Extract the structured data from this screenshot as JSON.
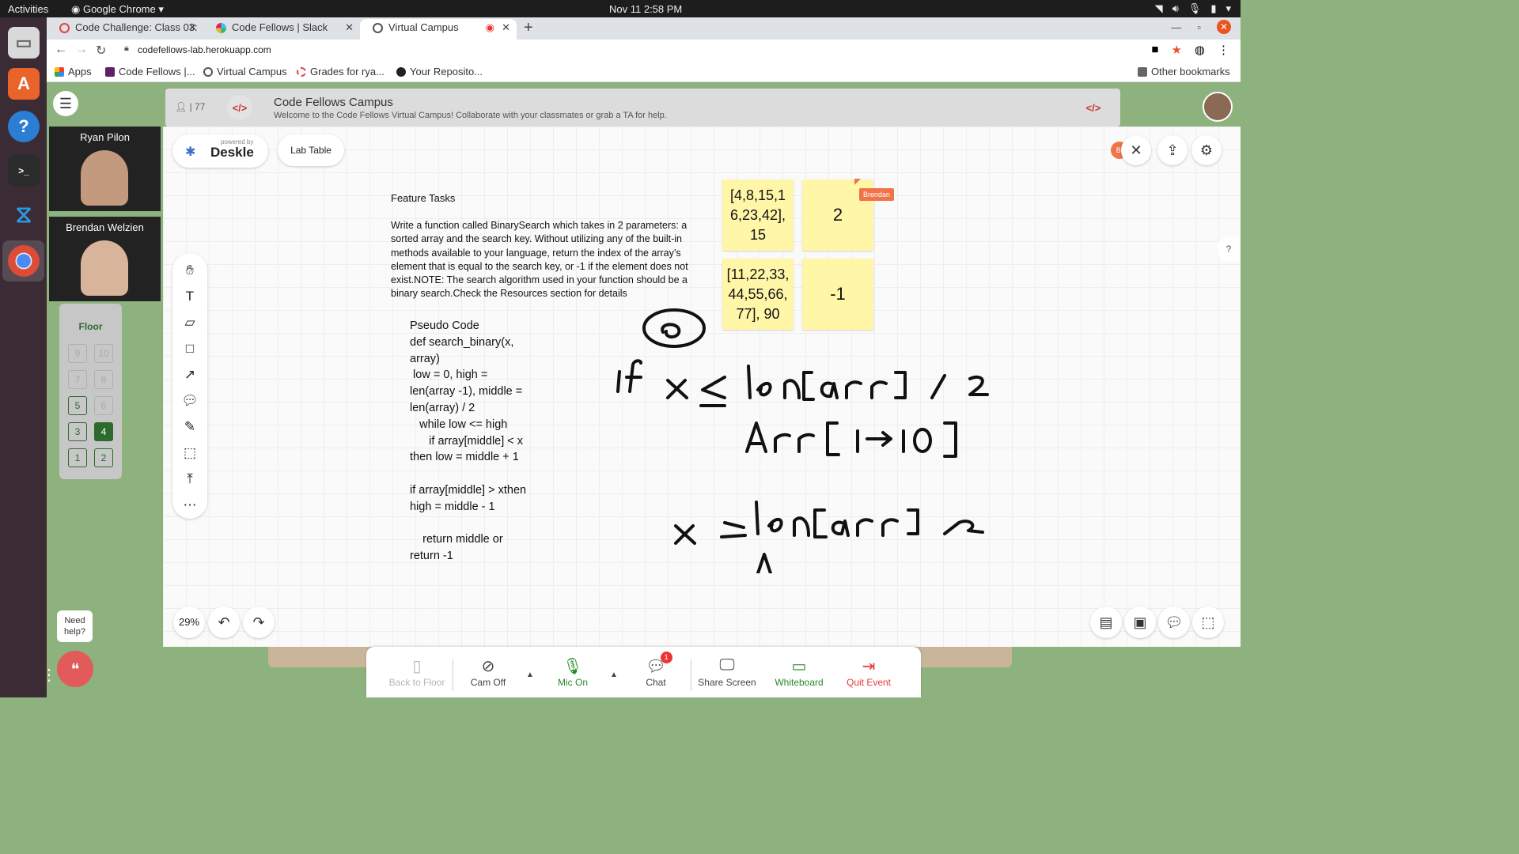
{
  "os": {
    "activities": "Activities",
    "app_menu": "Google Chrome",
    "clock": "Nov 11  2:58 PM"
  },
  "browser": {
    "tabs": [
      {
        "label": "Code Challenge: Class 03:",
        "color": "#e04545"
      },
      {
        "label": "Code Fellows | Slack",
        "color": "#611f69"
      },
      {
        "label": "Virtual Campus",
        "color": "#555555"
      }
    ],
    "new_tab": "+",
    "url": "codefellows-lab.herokuapp.com",
    "bookmarks": [
      {
        "label": "Apps"
      },
      {
        "label": "Code Fellows |..."
      },
      {
        "label": "Virtual Campus"
      },
      {
        "label": "Grades for rya..."
      },
      {
        "label": "Your Reposito..."
      }
    ],
    "other_bookmarks": "Other bookmarks"
  },
  "campus": {
    "user_count": "77",
    "title": "Code Fellows Campus",
    "subtitle": "Welcome to the Code Fellows Virtual Campus! Collaborate with your classmates or grab a TA for help.",
    "logo_glyph": "</>"
  },
  "participants": [
    {
      "name": "Ryan Pilon"
    },
    {
      "name": "Brendan Welzien"
    }
  ],
  "floor": {
    "label": "Floor",
    "buttons": [
      "9",
      "10",
      "7",
      "8",
      "5",
      "6",
      "3",
      "4",
      "1",
      "2"
    ],
    "current": "4"
  },
  "help": {
    "bubble": "Need help?"
  },
  "board": {
    "powered_by": "powered by",
    "brand": "Deskle",
    "room": "Lab Table",
    "avatar_initials": "B.",
    "zoom": "29%",
    "side_help": "?",
    "cursor_user": "Brendan",
    "feature_title": "Feature Tasks",
    "feature_body": "Write a function called BinarySearch which takes in 2 parameters: a sorted array and the search key. Without utilizing any of the built-in methods available to your language, return the index of the array’s element that is equal to the search key, or -1 if the element does not exist.NOTE: The search algorithm used in your function should be a binary search.Check the Resources section for details",
    "pseudo_code": "Pseudo Code\ndef search_binary(x, array)\n low = 0, high = len(array -1), middle = len(array) / 2\n   while low <= high\n      if array[middle] < x then low = middle + 1\n\nif array[middle] > xthen high = middle - 1\n\n    return middle or return -1",
    "stickies": [
      {
        "text": "[4,8,15,16,23,42], 15"
      },
      {
        "text": "2"
      },
      {
        "text": "[11,22,33,44,55,66,77], 90"
      },
      {
        "text": "-1"
      }
    ]
  },
  "controls": [
    {
      "label": "Back to Floor",
      "color": "#b5b5b5"
    },
    {
      "label": "Cam Off",
      "color": "#444444"
    },
    {
      "label": "Mic On",
      "color": "#2a8a2a"
    },
    {
      "label": "Chat",
      "color": "#444444",
      "badge": "1"
    },
    {
      "label": "Share Screen",
      "color": "#444444"
    },
    {
      "label": "Whiteboard",
      "color": "#2a8a2a"
    },
    {
      "label": "Quit Event",
      "color": "#e33b3b"
    }
  ]
}
